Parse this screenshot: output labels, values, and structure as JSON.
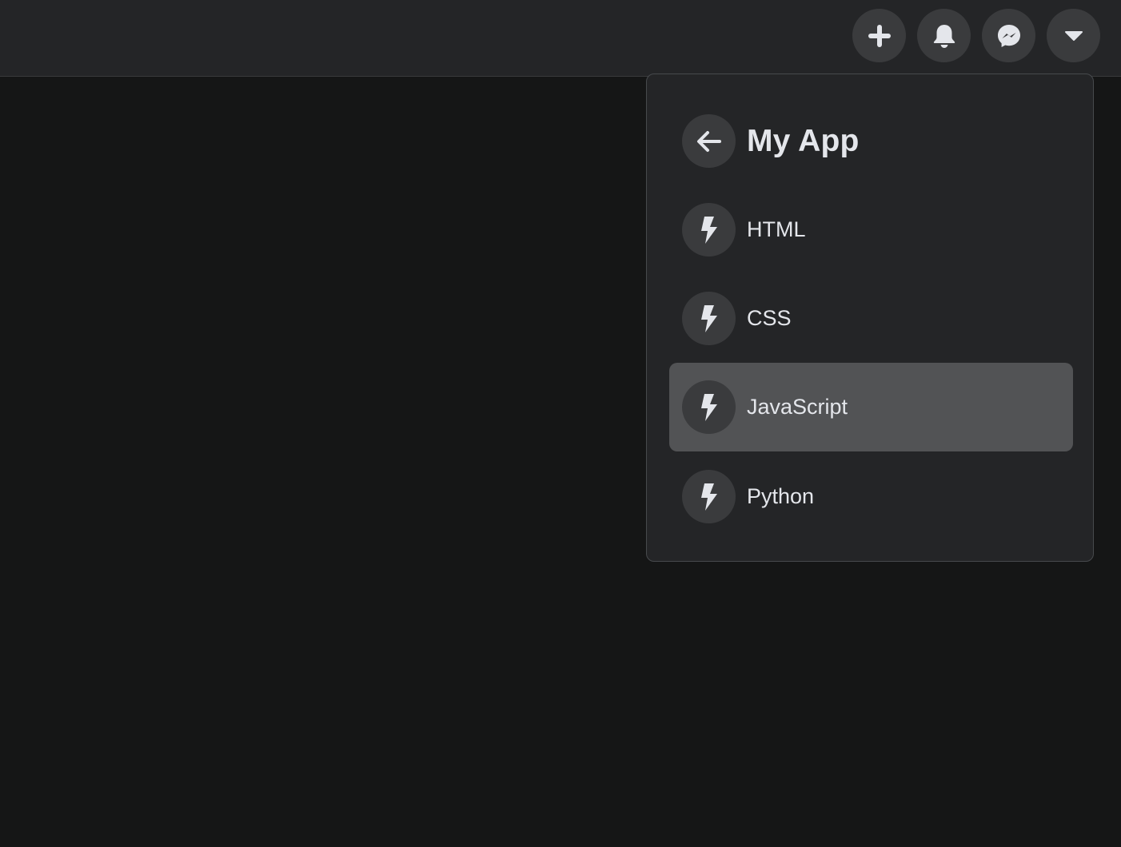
{
  "navbar": {
    "actions": [
      {
        "name": "add",
        "icon": "plus-icon"
      },
      {
        "name": "notifications",
        "icon": "bell-icon"
      },
      {
        "name": "messenger",
        "icon": "messenger-icon"
      },
      {
        "name": "account-menu",
        "icon": "caret-down-icon"
      }
    ]
  },
  "dropdown": {
    "header": {
      "back_icon": "arrow-left-icon",
      "title": "My App"
    },
    "items": [
      {
        "label": "HTML",
        "icon": "bolt-icon",
        "active": false
      },
      {
        "label": "CSS",
        "icon": "bolt-icon",
        "active": false
      },
      {
        "label": "JavaScript",
        "icon": "bolt-icon",
        "active": true
      },
      {
        "label": "Python",
        "icon": "bolt-icon",
        "active": false
      }
    ]
  },
  "colors": {
    "page_background": "#151616",
    "navbar_background": "#242527",
    "button_background": "#3a3b3d",
    "active_item_background": "#525355",
    "text": "#e4e6eb"
  }
}
